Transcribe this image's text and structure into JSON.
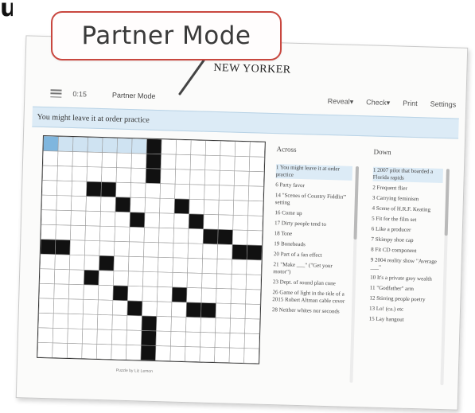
{
  "callout": {
    "label": "Partner Mode"
  },
  "page": {
    "logo": "NEW YORKER"
  },
  "toolbar": {
    "timer": "0:15",
    "mode_label": "Partner Mode",
    "buttons": [
      "Reveal▾",
      "Check▾",
      "Print",
      "Settings"
    ]
  },
  "clue_bar": {
    "text": "You might leave it at order practice"
  },
  "grid": {
    "size": 15,
    "blocks": [
      [
        0,
        7
      ],
      [
        1,
        7
      ],
      [
        2,
        7
      ],
      [
        3,
        3
      ],
      [
        3,
        4
      ],
      [
        4,
        5
      ],
      [
        4,
        9
      ],
      [
        5,
        6
      ],
      [
        5,
        10
      ],
      [
        6,
        11
      ],
      [
        6,
        12
      ],
      [
        7,
        0
      ],
      [
        7,
        1
      ],
      [
        7,
        13
      ],
      [
        7,
        14
      ],
      [
        8,
        4
      ],
      [
        9,
        3
      ],
      [
        10,
        5
      ],
      [
        10,
        9
      ],
      [
        11,
        6
      ],
      [
        11,
        10
      ],
      [
        11,
        11
      ],
      [
        12,
        7
      ],
      [
        13,
        7
      ],
      [
        14,
        7
      ]
    ],
    "highlight_row": 0,
    "highlight_cols": [
      0,
      1,
      2,
      3,
      4,
      5,
      6
    ],
    "selected_cell": [
      0,
      0
    ],
    "credit": "Puzzle by Liz Lemon"
  },
  "across": {
    "title": "Across",
    "clues": [
      "1 You might leave it at order practice",
      "6 Party favor",
      "14 \"Scenes of Country Fiddlin'\" setting",
      "16 Come up",
      "17 Dirty people tend to",
      "18 Tone",
      "19 Boneheads",
      "20 Part of a fan effect",
      "21 \"Make ___\" (\"Get your motor\")",
      "23 Dept. of sound plan cone",
      "26 Game of light in the title of a 2015 Robert Altman cable cover",
      "28 Neither whites nor seconds"
    ]
  },
  "down": {
    "title": "Down",
    "clues": [
      "1 2007 pilot that boarded a Florida rapids",
      "2 Frequent flier",
      "3 Carrying feminism",
      "4 Scene of H.R.F. Keating",
      "5 Fit for the film set",
      "6 Like a producer",
      "7 Skimpy shoe cap",
      "8 Fit CD component",
      "9 2004 reality show \"Average ___\"",
      "10 It's a private grey wealth",
      "11 \"Godfather\" arm",
      "12 Stirring people poetry",
      "13 Lo! (ca.) etc",
      "15 Lay hangout"
    ]
  }
}
